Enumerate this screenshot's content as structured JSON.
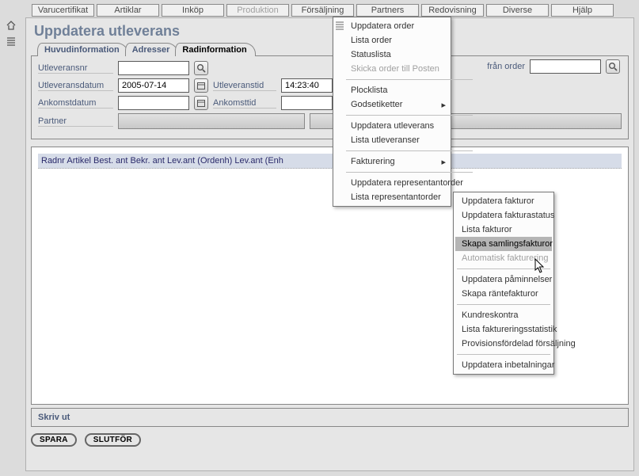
{
  "topbar": {
    "items": [
      {
        "label": "Varucertifikat"
      },
      {
        "label": "Artiklar"
      },
      {
        "label": "Inköp"
      },
      {
        "label": "Produktion",
        "disabled": true
      },
      {
        "label": "Försäljning"
      },
      {
        "label": "Partners"
      },
      {
        "label": "Redovisning"
      },
      {
        "label": "Diverse"
      },
      {
        "label": "Hjälp"
      }
    ]
  },
  "page_title": "Uppdatera utleverans",
  "tabs": [
    {
      "label": "Huvudinformation"
    },
    {
      "label": "Adresser"
    },
    {
      "label": "Radinformation",
      "active": true
    }
  ],
  "form": {
    "utleveransnr": {
      "label": "Utleveransnr",
      "value": ""
    },
    "utleveransdatum": {
      "label": "Utleveransdatum",
      "value": "2005-07-14"
    },
    "utleveranstid": {
      "label": "Utleveranstid",
      "value": "14:23:40"
    },
    "ankomstdatum": {
      "label": "Ankomstdatum",
      "value": ""
    },
    "ankomsttid": {
      "label": "Ankomsttid",
      "value": ""
    },
    "partner": {
      "label": "Partner",
      "value": ""
    },
    "search_right": {
      "label": "från order",
      "value": ""
    }
  },
  "table": {
    "header": "Radnr Artikel Best. ant Bekr. ant Lev.ant (Ordenh) Lev.ant (Enh"
  },
  "footer": {
    "label": "Skriv ut"
  },
  "actions": {
    "spara": "SPARA",
    "slutfor": "SLUTFÖR"
  },
  "menu1": {
    "items": [
      {
        "label": "Uppdatera order"
      },
      {
        "label": "Lista order"
      },
      {
        "label": "Statuslista"
      },
      {
        "label": "Skicka order till Posten",
        "disabled": true
      },
      {
        "sep": true
      },
      {
        "label": "Plocklista"
      },
      {
        "label": "Godsetiketter",
        "arrow": true
      },
      {
        "sep": true
      },
      {
        "label": "Uppdatera utleverans"
      },
      {
        "label": "Lista utleveranser"
      },
      {
        "sep": true
      },
      {
        "label": "Fakturering",
        "arrow": true
      },
      {
        "sep": true
      },
      {
        "label": "Uppdatera representantorder"
      },
      {
        "label": "Lista representantorder"
      }
    ]
  },
  "menu2": {
    "items": [
      {
        "label": "Uppdatera fakturor"
      },
      {
        "label": "Uppdatera fakturastatus"
      },
      {
        "label": "Lista fakturor"
      },
      {
        "label": "Skapa samlingsfakturor",
        "highlight": true
      },
      {
        "label": "Automatisk fakturering",
        "disabled": true
      },
      {
        "sep": true
      },
      {
        "label": "Uppdatera påminnelser"
      },
      {
        "label": "Skapa räntefakturor"
      },
      {
        "sep": true
      },
      {
        "label": "Kundreskontra"
      },
      {
        "label": "Lista faktureringsstatistik"
      },
      {
        "label": "Provisionsfördelad försäljning"
      },
      {
        "sep": true
      },
      {
        "label": "Uppdatera inbetalningar"
      }
    ]
  }
}
